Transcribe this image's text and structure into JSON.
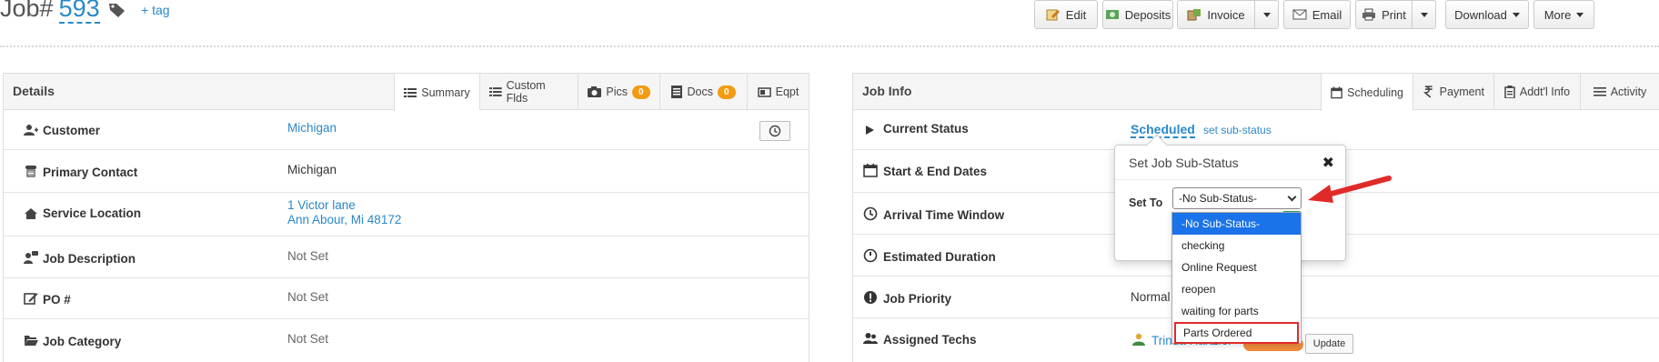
{
  "header": {
    "job_label": "Job#",
    "job_number": "593",
    "add_tag": "+ tag"
  },
  "toolbar": {
    "edit": "Edit",
    "deposits": "Deposits",
    "invoice": "Invoice",
    "email": "Email",
    "print": "Print",
    "download": "Download",
    "more": "More"
  },
  "details": {
    "title": "Details",
    "tabs": [
      {
        "label": "Summary"
      },
      {
        "label": "Custom Flds"
      },
      {
        "label": "Pics",
        "badge": "0"
      },
      {
        "label": "Docs",
        "badge": "0"
      },
      {
        "label": "Eqpt"
      }
    ],
    "rows": {
      "customer": {
        "label": "Customer",
        "value": "Michigan"
      },
      "primary_contact": {
        "label": "Primary Contact",
        "value": "Michigan"
      },
      "service_location": {
        "label": "Service Location",
        "line1": "1 Victor lane",
        "line2": "Ann Abour, Mi 48172"
      },
      "job_description": {
        "label": "Job Description",
        "value": "Not Set"
      },
      "po": {
        "label": "PO #",
        "value": "Not Set"
      },
      "job_category": {
        "label": "Job Category",
        "value": "Not Set"
      }
    }
  },
  "jobinfo": {
    "title": "Job Info",
    "tabs": [
      {
        "label": "Scheduling"
      },
      {
        "label": "Payment"
      },
      {
        "label": "Addt'l Info"
      },
      {
        "label": "Activity"
      }
    ],
    "rows": {
      "current_status": {
        "label": "Current Status",
        "value": "Scheduled",
        "sub_link": "set sub-status"
      },
      "dates": {
        "label": "Start & End Dates"
      },
      "arrival": {
        "label": "Arrival Time Window"
      },
      "duration": {
        "label": "Estimated Duration"
      },
      "priority": {
        "label": "Job Priority",
        "value": "Normal"
      },
      "techs": {
        "label": "Assigned Techs",
        "value": "Trinda Hartzler",
        "update": "Update"
      }
    }
  },
  "popover": {
    "title": "Set Job Sub-Status",
    "set_to_label": "Set To",
    "selected": "-No Sub-Status-",
    "options": [
      "-No Sub-Status-",
      "checking",
      "Online Request",
      "reopen",
      "waiting for parts",
      "Parts Ordered"
    ]
  },
  "colors": {
    "link": "#2a88c9",
    "badge": "#f39c12",
    "selected_option": "#1a73e8",
    "annotation_red": "#e02a2a"
  }
}
